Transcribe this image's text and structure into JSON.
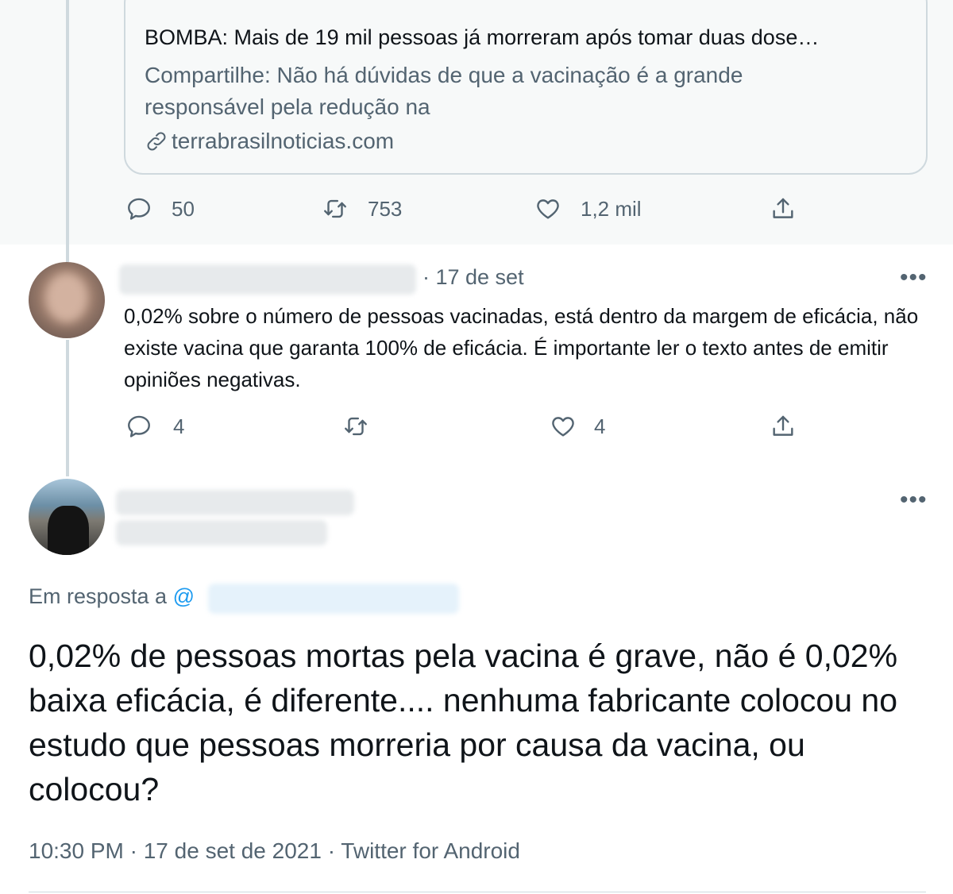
{
  "quoted_card": {
    "title": "BOMBA: Mais de 19 mil pessoas já morreram após tomar duas dose…",
    "description": "Compartilhe: Não há dúvidas de que a vacinação é a grande responsável pela redução na",
    "domain": "terrabrasilnoticias.com"
  },
  "top_actions": {
    "replies": "50",
    "retweets": "753",
    "likes": "1,2 mil"
  },
  "reply_tweet": {
    "date": "· 17 de set",
    "text": "0,02% sobre o número de pessoas vacinadas, está dentro da margem de eficácia, não existe vacina que garanta 100% de eficácia. É importante ler o texto antes de emitir opiniões negativas.",
    "actions": {
      "replies": "4",
      "likes": "4"
    }
  },
  "main_tweet": {
    "in_reply_prefix": "Em resposta a",
    "in_reply_at": "@",
    "text": "0,02% de pessoas mortas pela vacina é grave, não é 0,02% baixa eficácia, é diferente.... nenhuma fabricante colocou no estudo que pessoas morreria por causa da vacina, ou colocou?",
    "meta": "10:30 PM · 17 de set de 2021 · Twitter for Android"
  },
  "more_label": "•••",
  "icons": [
    "reply-icon",
    "retweet-icon",
    "like-icon",
    "share-icon",
    "link-icon",
    "more-icon"
  ],
  "colors": {
    "text": "#0f1419",
    "secondary": "#536471",
    "accent": "#1d9bf0",
    "border": "#cfd9de",
    "tinted_bg": "#f7f9f9"
  }
}
